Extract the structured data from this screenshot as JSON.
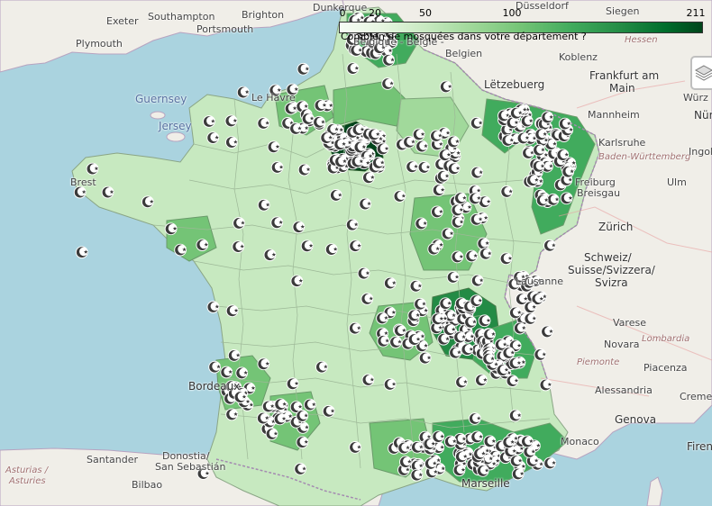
{
  "legend": {
    "ticks": [
      "0",
      "20",
      "50",
      "100",
      "211"
    ],
    "caption": "Combien de mosquées dans votre département ?",
    "colors": [
      "#f7fcf5",
      "#c7e9c0",
      "#74c476",
      "#238b45",
      "#00441b"
    ]
  },
  "places": {
    "exeter": "Exeter",
    "southampton": "Southampton",
    "brighton": "Brighton",
    "plymouth": "Plymouth",
    "portsmouth": "Portsmouth",
    "dunkerque": "Dunkerque",
    "dusseldorf": "Düsseldorf",
    "siegen": "Siegen",
    "belgique": "Belgique - België -",
    "belgien": "Belgien",
    "hessen": "Hessen",
    "koblenz": "Koblenz",
    "frankfurt1": "Frankfurt am",
    "frankfurt2": "Main",
    "letzebuerg": "Lëtzebuerg",
    "wurzburg": "Würz",
    "mannheim": "Mannheim",
    "nurn": "Nürn",
    "guernsey": "Guernsey",
    "jersey": "Jersey",
    "lehavre": "Le Havre",
    "karlsruhe": "Karlsruhe",
    "bw": "Baden-Württemberg",
    "ingolstadt": "Ingols",
    "brest": "Brest",
    "ulm": "Ulm",
    "freiburg1": "Freiburg",
    "freiburg2": "Breisgau",
    "zurich": "Zürich",
    "schweiz1": "Schweiz/",
    "schweiz2": "Suisse/Svizzera/",
    "schweiz3": "Svizra",
    "lausanne": "Lausanne",
    "varese": "Varese",
    "novara": "Novara",
    "lombardia": "Lombardia",
    "piemonte": "Piemonte",
    "piacenza": "Piacenza",
    "alessandria": "Alessandria",
    "bordeaux": "Bordeaux",
    "cremona": "Creme",
    "genova": "Genova",
    "monaco": "Monaco",
    "firenze": "Firen",
    "santander": "Santander",
    "donostia1": "Donostia/",
    "donostia2": "San Sebastián",
    "asturias1": "Asturias /",
    "asturias2": "Asturies",
    "bilbao": "Bilbao",
    "marseille": "Marseille"
  }
}
